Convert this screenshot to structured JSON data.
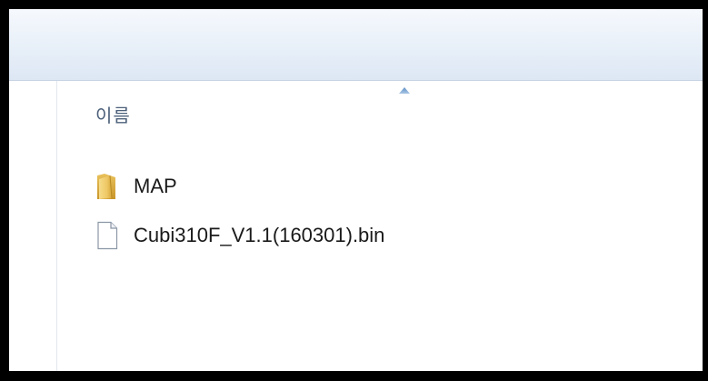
{
  "window": {
    "column_header": {
      "name_label": "이름",
      "sort_indicator": "sort-ascending-arrow"
    },
    "files": [
      {
        "name": "MAP",
        "type": "folder",
        "icon": "folder-icon"
      },
      {
        "name": "Cubi310F_V1.1(160301).bin",
        "type": "file",
        "icon": "file-icon"
      }
    ]
  },
  "colors": {
    "toolbar_top": "#f6f9fd",
    "toolbar_bottom": "#dde7f4",
    "header_text": "#4c607a",
    "folder_yellow": "#e9c15a"
  }
}
